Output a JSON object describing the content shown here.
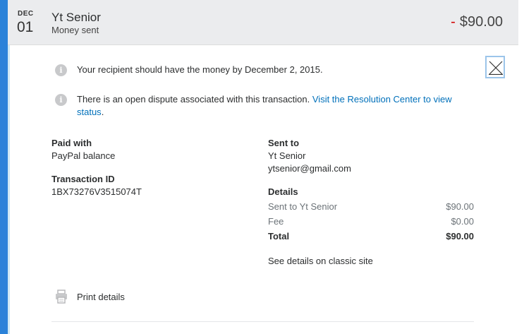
{
  "header": {
    "month": "DEC",
    "day": "01",
    "name": "Yt Senior",
    "type": "Money sent",
    "amount_sign": "-",
    "amount": "$90.00"
  },
  "notices": [
    {
      "text": "Your recipient should have the money by December 2, 2015.",
      "link": "",
      "link_suffix": ""
    },
    {
      "text": "There is an open dispute associated with this transaction.",
      "link": "Visit the Resolution Center to view status",
      "link_suffix": "."
    }
  ],
  "paid_with": {
    "label": "Paid with",
    "value": "PayPal balance"
  },
  "transaction_id": {
    "label": "Transaction ID",
    "value": "1BX73276V3515074T"
  },
  "sent_to": {
    "label": "Sent to",
    "name": "Yt Senior",
    "email": "ytsenior@gmail.com"
  },
  "details": {
    "label": "Details",
    "rows": [
      {
        "label": "Sent to Yt Senior",
        "value": "$90.00"
      },
      {
        "label": "Fee",
        "value": "$0.00"
      },
      {
        "label": "Total",
        "value": "$90.00"
      }
    ],
    "classic_link": "See details on classic site"
  },
  "print": {
    "label": "Print details"
  },
  "colors": {
    "accent": "#2b82d9",
    "link": "#0070ba",
    "negative": "#d20000"
  },
  "icons": {
    "info": "info-icon",
    "close": "close-icon",
    "print": "printer-icon"
  }
}
